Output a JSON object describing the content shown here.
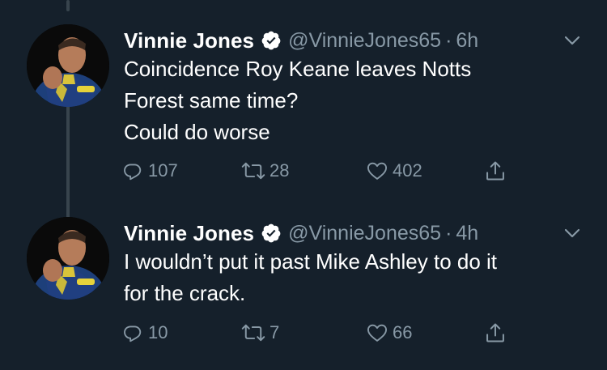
{
  "tweets": [
    {
      "name": "Vinnie Jones",
      "handle": "@VinnieJones65",
      "separator": "·",
      "time": "6h",
      "text_lines": [
        "Coincidence Roy Keane leaves Notts",
        "Forest same time?",
        "Could do worse"
      ],
      "replies": "107",
      "retweets": "28",
      "likes": "402"
    },
    {
      "name": "Vinnie Jones",
      "handle": "@VinnieJones65",
      "separator": "·",
      "time": "4h",
      "text_lines": [
        "I wouldn’t put it past Mike Ashley to do it",
        "for the crack."
      ],
      "replies": "10",
      "retweets": "7",
      "likes": "66"
    }
  ],
  "icons": {
    "verified": "verified-badge-icon",
    "menu": "chevron-down-icon",
    "reply": "reply-icon",
    "retweet": "retweet-icon",
    "like": "heart-icon",
    "share": "share-icon"
  },
  "colors": {
    "background": "#15202b",
    "secondary_text": "#8899a6",
    "thread_line": "#38444d",
    "primary_text": "#ffffff"
  }
}
